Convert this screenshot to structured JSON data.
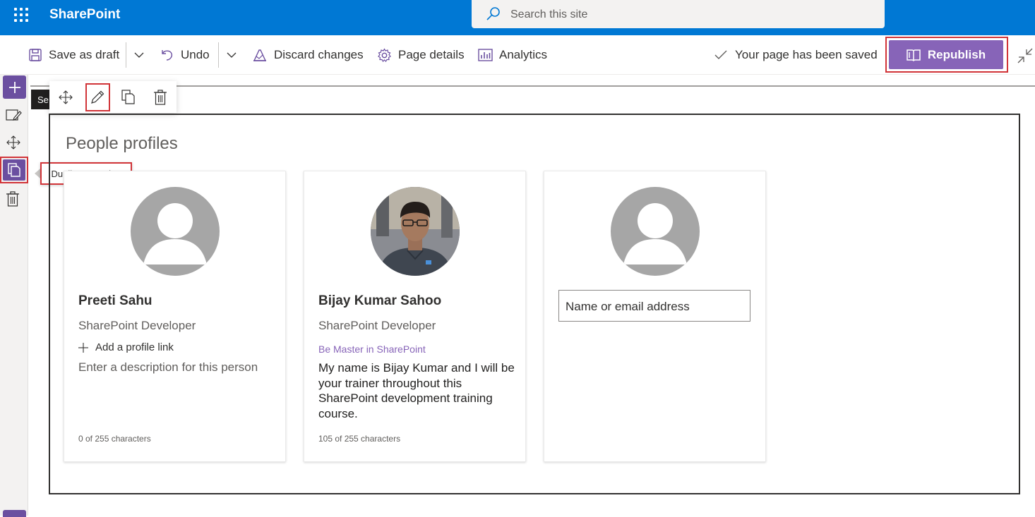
{
  "suite": {
    "app_name": "SharePoint",
    "search_placeholder": "Search this site"
  },
  "commandbar": {
    "save_draft": "Save as draft",
    "undo": "Undo",
    "discard": "Discard changes",
    "page_details": "Page details",
    "analytics": "Analytics",
    "status": "Your page has been saved",
    "republish": "Republish"
  },
  "section_label": "Se",
  "tooltip": "Duplicate section",
  "webpart": {
    "title": "People profiles",
    "cards": [
      {
        "name": "Preeti Sahu",
        "role": "SharePoint Developer",
        "add_link": "Add a profile link",
        "description_placeholder": "Enter a description for this person",
        "char_count": "0 of 255 characters"
      },
      {
        "name": "Bijay Kumar Sahoo",
        "role": "SharePoint Developer",
        "link": "Be Master in SharePoint",
        "description": "My name is Bijay Kumar and I will be your trainer throughout this SharePoint development training course.",
        "char_count": "105 of 255 characters"
      },
      {
        "input_placeholder": "Name or email address"
      }
    ]
  },
  "colors": {
    "suite_bar": "#0078d4",
    "accent": "#8764b8",
    "rail_accent": "#6b4fa0",
    "highlight": "#d13438"
  }
}
